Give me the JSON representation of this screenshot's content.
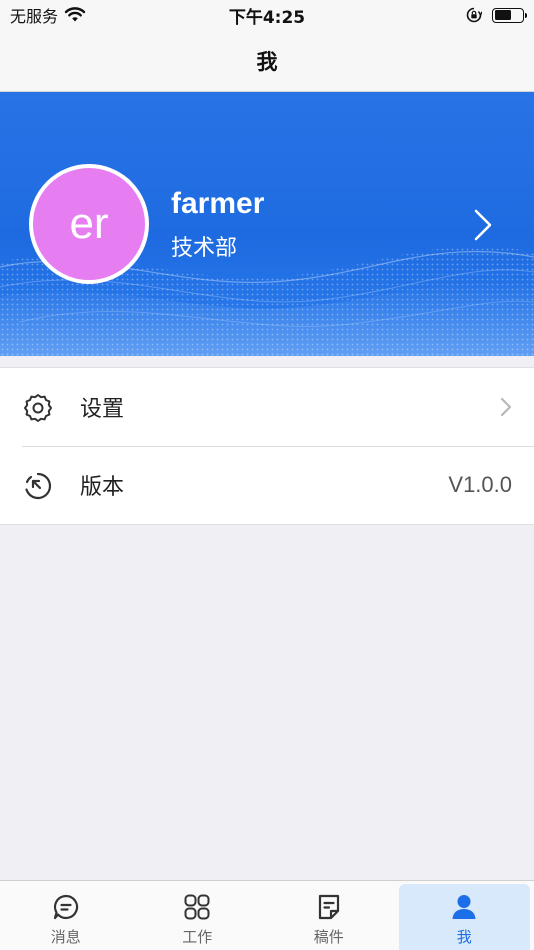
{
  "status_bar": {
    "carrier": "无服务",
    "time": "下午4:25",
    "battery_level": 0.6
  },
  "nav": {
    "title": "我"
  },
  "profile": {
    "avatar_text": "er",
    "avatar_color": "#e67ef2",
    "name": "farmer",
    "department": "技术部",
    "banner_color": "#2070e4"
  },
  "list": {
    "settings_label": "设置",
    "version_label": "版本",
    "version_value": "V1.0.0"
  },
  "tabs": [
    {
      "label": "消息",
      "icon": "message-icon",
      "active": false
    },
    {
      "label": "工作",
      "icon": "grid-icon",
      "active": false
    },
    {
      "label": "稿件",
      "icon": "document-icon",
      "active": false
    },
    {
      "label": "我",
      "icon": "person-icon",
      "active": true
    }
  ],
  "colors": {
    "accent": "#1c6fe8",
    "inactive_tab": "#666666"
  }
}
